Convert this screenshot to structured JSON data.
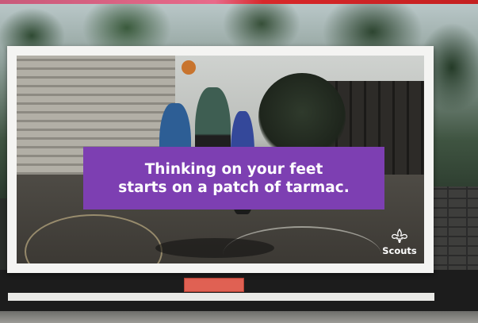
{
  "billboard": {
    "headline_line1": "Thinking on your feet",
    "headline_line2": "starts on a patch of tarmac.",
    "logo_text": "Scouts",
    "logo_icon": "fleur-de-lis-icon",
    "headline_bg": "#7d3fb2"
  }
}
